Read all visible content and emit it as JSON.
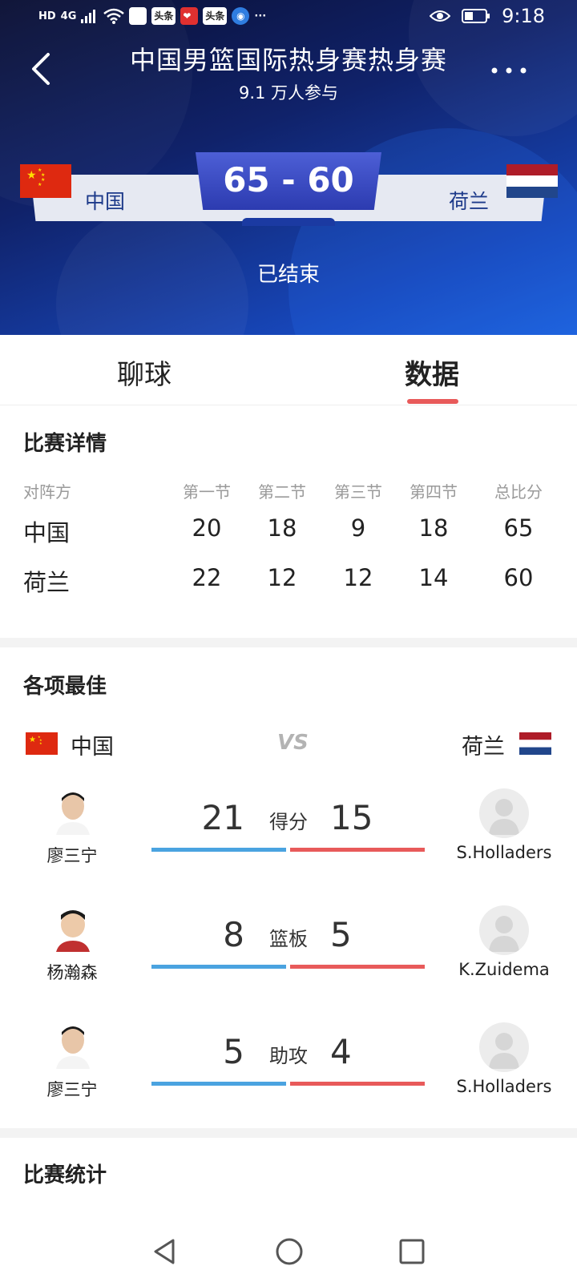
{
  "status_bar": {
    "network_label": "HD",
    "signal_label": "4G",
    "app_chip_1": "头条",
    "app_chip_2": "头条",
    "time": "9:18"
  },
  "header": {
    "title": "中国男篮国际热身赛热身赛",
    "subtitle": "9.1 万人参与",
    "home_team": "中国",
    "away_team": "荷兰",
    "score": "65 - 60",
    "state": "已结束"
  },
  "tabs": [
    {
      "label": "聊球",
      "active": false
    },
    {
      "label": "数据",
      "active": true
    }
  ],
  "match_details": {
    "title": "比赛详情",
    "headers": [
      "对阵方",
      "第一节",
      "第二节",
      "第三节",
      "第四节",
      "总比分"
    ],
    "rows": [
      {
        "team": "中国",
        "q1": "20",
        "q2": "18",
        "q3": "9",
        "q4": "18",
        "total": "65"
      },
      {
        "team": "荷兰",
        "q1": "22",
        "q2": "12",
        "q3": "12",
        "q4": "14",
        "total": "60"
      }
    ]
  },
  "best": {
    "title": "各项最佳",
    "home_team": "中国",
    "away_team": "荷兰",
    "vs": "VS",
    "rows": [
      {
        "home_player": "廖三宁",
        "home_value": "21",
        "label": "得分",
        "away_value": "15",
        "away_player": "S.Holladers"
      },
      {
        "home_player": "杨瀚森",
        "home_value": "8",
        "label": "篮板",
        "away_value": "5",
        "away_player": "K.Zuidema"
      },
      {
        "home_player": "廖三宁",
        "home_value": "5",
        "label": "助攻",
        "away_value": "4",
        "away_player": "S.Holladers"
      }
    ]
  },
  "stats": {
    "title": "比赛统计"
  },
  "colors": {
    "home_bar": "#4aa3e0",
    "away_bar": "#e85a5a",
    "accent": "#e85a5a",
    "score_box": "#2c3bb0"
  },
  "icons": {
    "back": "chevron-left-icon",
    "more": "more-dots-icon",
    "eye": "eye-icon",
    "battery": "battery-icon",
    "wifi": "wifi-icon"
  }
}
